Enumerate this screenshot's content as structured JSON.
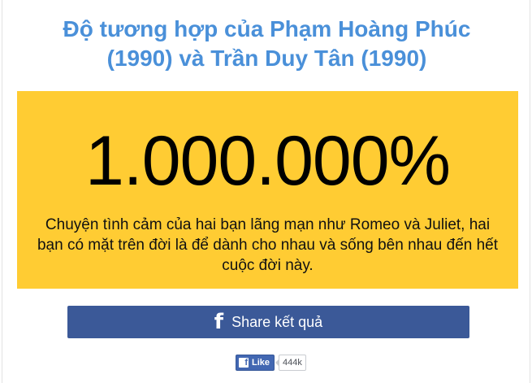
{
  "header": {
    "title_line1": "Độ tương hợp của Phạm Hoàng Phúc",
    "title_line2": "(1990) và Trần Duy Tân (1990)"
  },
  "result": {
    "percent": "1.000.000%",
    "message": "Chuyện tình cảm của hai bạn lãng mạn như Romeo và Juliet, hai bạn có mặt trên đời là để dành cho nhau và sống bên nhau đến hết cuộc đời này."
  },
  "share": {
    "label": "Share kết quả",
    "icon": "facebook-icon"
  },
  "like": {
    "label": "Like",
    "count": "444k",
    "icon": "facebook-icon"
  },
  "colors": {
    "title": "#4a90d9",
    "result_background": "#ffcc33",
    "share_button": "#3b5998",
    "like_button": "#4267b2"
  }
}
